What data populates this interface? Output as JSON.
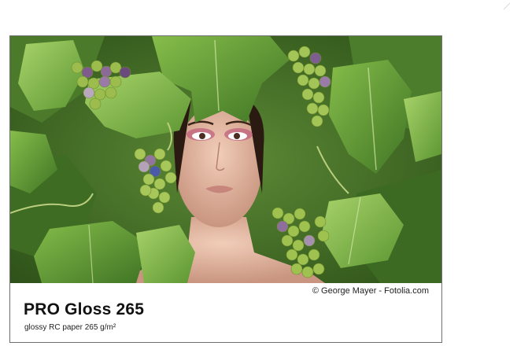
{
  "product": {
    "title": "PRO Gloss 265",
    "subtitle": "glossy RC paper 265 g/m²"
  },
  "photo": {
    "credit": "© George Mayer - Fotolia.com",
    "subject": "woman-with-grape-leaves"
  },
  "colors": {
    "leaf_dark": "#2f5a1c",
    "leaf_light": "#6fa83c",
    "grape_green": "#a9c65a",
    "grape_purple": "#6b4a7a",
    "skin": "#e3b9a2",
    "border": "#6f6f6f"
  }
}
